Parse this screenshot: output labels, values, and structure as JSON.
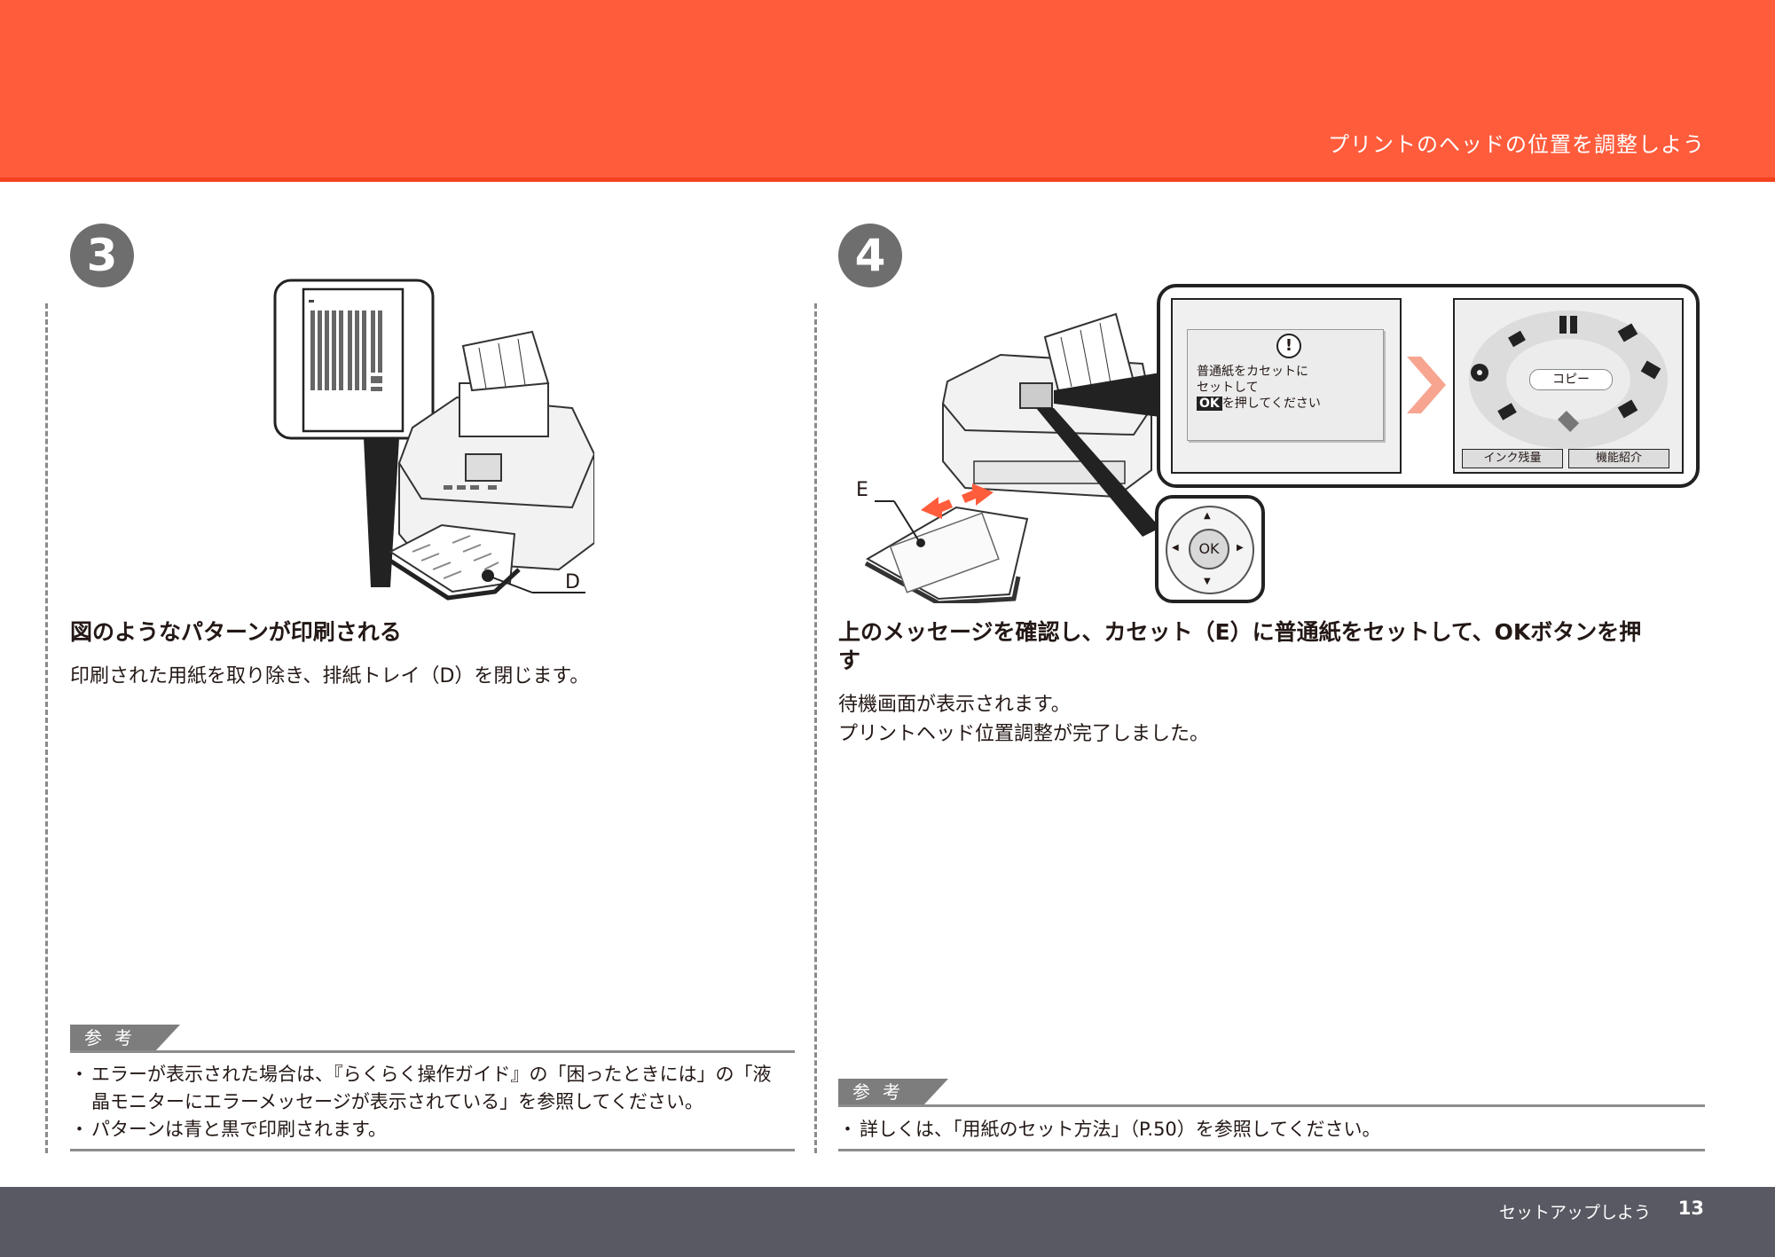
{
  "header": {
    "title": "プリントのヘッドの位置を調整しよう"
  },
  "footer": {
    "section": "セットアップしよう",
    "page": "13"
  },
  "step3": {
    "number": "3",
    "callout_label": "D",
    "heading": "図のようなパターンが印刷される",
    "body": "印刷された用紙を取り除き、排紙トレイ（D）を閉じます。",
    "reference": {
      "tab": "参考",
      "items": [
        "エラーが表示された場合は、『らくらく操作ガイド』の「困ったときには」の「液晶モニターにエラーメッセージが表示されている」を参照してください。",
        "パターンは青と黒で印刷されます。"
      ]
    }
  },
  "step4": {
    "number": "4",
    "callout_label": "E",
    "lcd_message": {
      "line1": "普通紙をカセットに",
      "line2": "セットして",
      "ok_badge": "OK",
      "line3": "を押してください"
    },
    "menu_center": "コピー",
    "menu_buttons": [
      "インク残量",
      "機能紹介"
    ],
    "ok_button": "OK",
    "heading": "上のメッセージを確認し、カセット（E）に普通紙をセットして、OKボタンを押す",
    "body": [
      "待機画面が表示されます。",
      "プリントヘッド位置調整が完了しました。"
    ],
    "reference": {
      "tab": "参考",
      "items": [
        "詳しくは、「用紙のセット方法」（P.50）を参照してください。"
      ]
    }
  },
  "colors": {
    "header": "#ff5c3c",
    "footer": "#585962",
    "step_badge": "#6e6e6e"
  }
}
